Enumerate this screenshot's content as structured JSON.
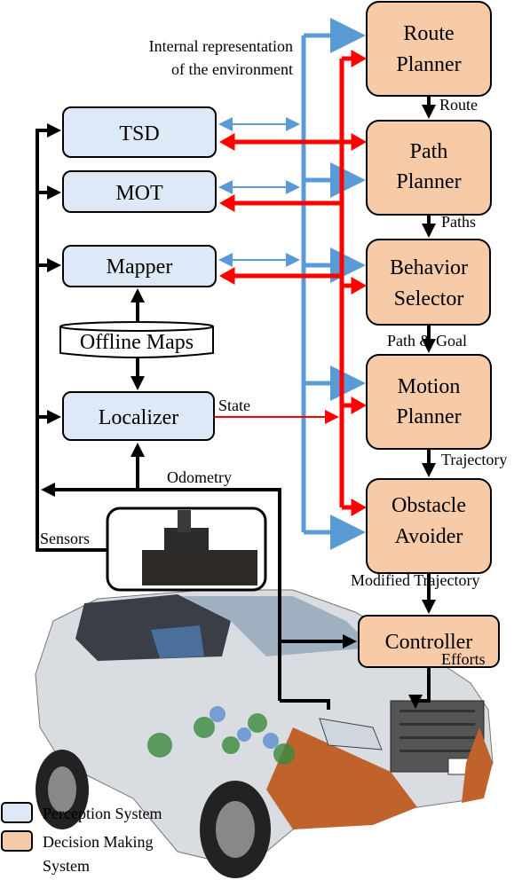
{
  "colors": {
    "perception": "#dde9f6",
    "decision": "#f7caa8",
    "blue_flow": "#5b9bd5",
    "red_flow": "#ff0000",
    "black_flow": "#000000"
  },
  "caption": {
    "line1": "Internal representation",
    "line2": "of the environment"
  },
  "perception": {
    "tsd": "TSD",
    "mot": "MOT",
    "mapper": "Mapper",
    "offline_maps": "Offline Maps",
    "localizer": "Localizer"
  },
  "decision": {
    "route_planner": [
      "Route",
      "Planner"
    ],
    "path_planner": [
      "Path",
      "Planner"
    ],
    "behavior_selector": [
      "Behavior",
      "Selector"
    ],
    "motion_planner": [
      "Motion",
      "Planner"
    ],
    "obstacle_avoider": [
      "Obstacle",
      "Avoider"
    ],
    "controller": "Controller"
  },
  "edges": {
    "route": "Route",
    "paths": "Paths",
    "path_goal": "Path & Goal",
    "trajectory": "Trajectory",
    "modified_trajectory": "Modified Trajectory",
    "efforts": "Efforts",
    "state": "State",
    "odometry": "Odometry",
    "sensors": "Sensors"
  },
  "legend": {
    "perception": "Perception System",
    "decision_line1": "Decision Making",
    "decision_line2": "System"
  }
}
